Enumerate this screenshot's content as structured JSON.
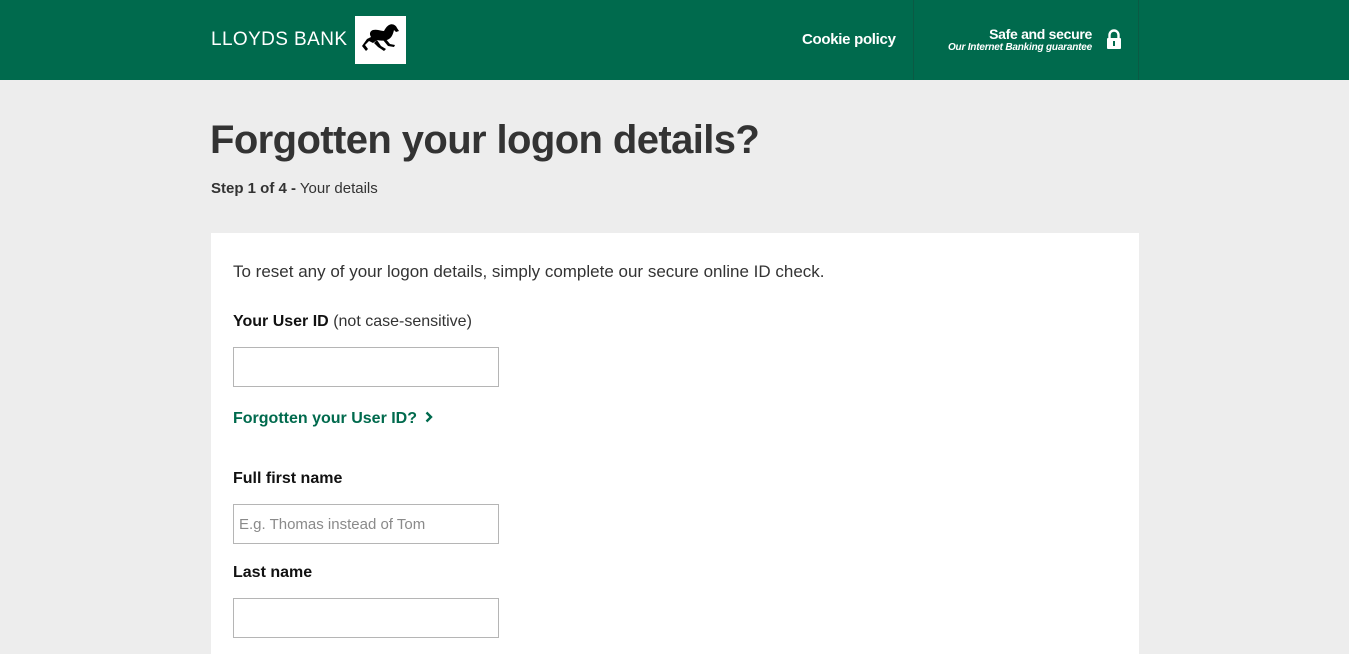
{
  "header": {
    "brand_name": "LLOYDS BANK",
    "cookie_link": "Cookie policy",
    "secure_title": "Safe and secure",
    "secure_subtitle": "Our Internet Banking guarantee",
    "background": "#006a4d"
  },
  "page": {
    "title": "Forgotten your logon details?",
    "step_label": "Step 1 of 4 -",
    "step_text": "Your details"
  },
  "form": {
    "intro": "To reset any of your logon details, simply complete our secure online ID check.",
    "user_id_label": "Your User ID",
    "user_id_hint": "(not case-sensitive)",
    "user_id_value": "",
    "forgot_user_id_link": "Forgotten your User ID?",
    "first_name_label": "Full first name",
    "first_name_placeholder": "E.g. Thomas instead of Tom",
    "last_name_label": "Last name",
    "last_name_value": ""
  },
  "icons": {
    "logo": "black-horse-logo",
    "lock": "lock-icon",
    "chevron": "chevron-right-icon"
  },
  "colors": {
    "brand_green": "#006a4d",
    "page_background": "#ededed",
    "text": "#333333"
  }
}
